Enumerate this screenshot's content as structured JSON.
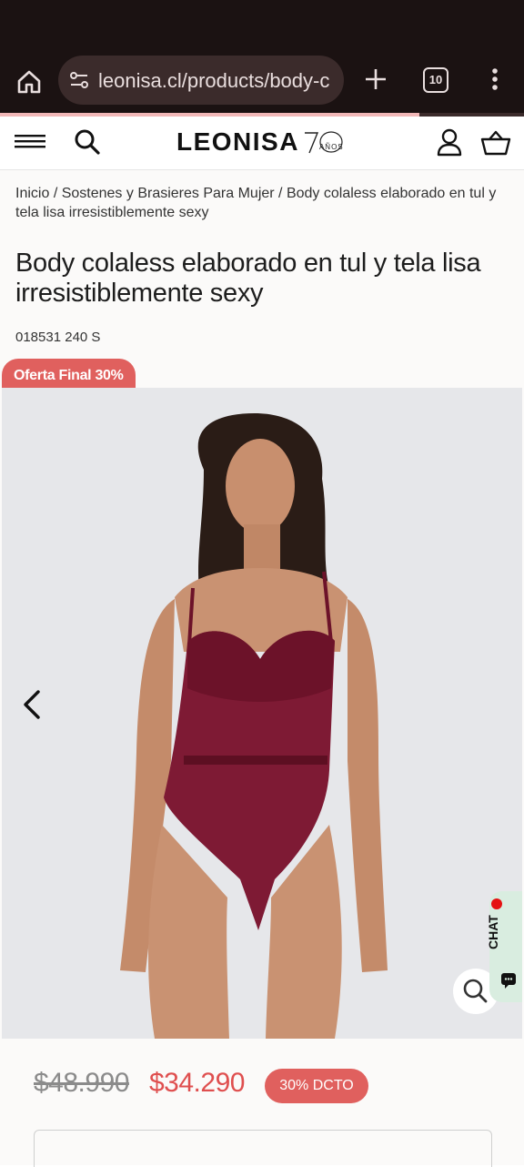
{
  "browser": {
    "url": "leonisa.cl/products/body-c",
    "tab_count": "10",
    "load_progress": 0.8,
    "icons": [
      "home-icon",
      "site-settings-icon",
      "plus-icon",
      "tabs-icon",
      "more-vert-icon"
    ]
  },
  "header": {
    "logo_text": "LEONISA",
    "logo_badge_number": "70",
    "logo_badge_text": "AÑOS",
    "icons": [
      "menu-icon",
      "search-icon",
      "user-icon",
      "basket-icon"
    ]
  },
  "breadcrumb": {
    "items": [
      "Inicio",
      "Sostenes y Brasieres Para Mujer",
      "Body colaless elaborado en tul y tela lisa irresistiblemente sexy"
    ],
    "separator": "/"
  },
  "product": {
    "title": "Body colaless elaborado en tul y tela lisa irresistiblemente sexy",
    "sku": "018531 240 S",
    "offer_badge": "Oferta Final 30%",
    "old_price": "$48.990",
    "new_price": "$34.290",
    "discount": "30% DCTO"
  },
  "gallery": {
    "chat_label": "CHAT",
    "icons": [
      "chevron-left-icon",
      "zoom-icon",
      "chat-icon"
    ]
  },
  "colors": {
    "browser_bg": "#1b1212",
    "accent_red": "#e0605e",
    "price_red": "#df4f4f",
    "garment": "#7e1a34",
    "chat_bg": "#d9ede0"
  }
}
